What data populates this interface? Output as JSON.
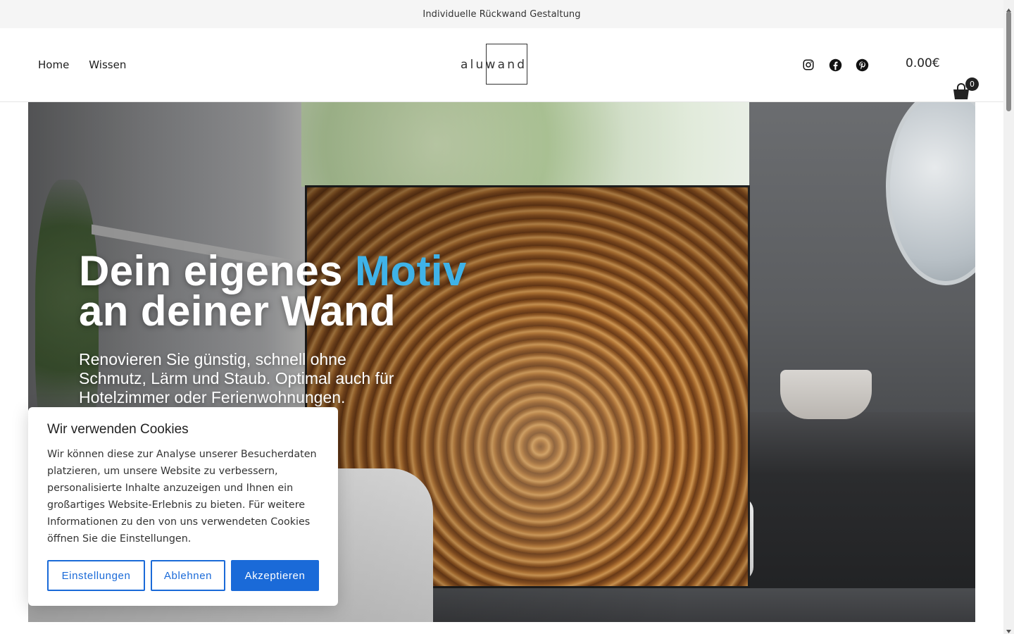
{
  "topbar": {
    "text": "Individuelle Rückwand Gestaltung"
  },
  "nav": {
    "items": [
      {
        "label": "Home"
      },
      {
        "label": "Wissen"
      }
    ]
  },
  "logo": {
    "part1": "alu",
    "part2": "wand"
  },
  "socials": [
    {
      "icon": "instagram-icon"
    },
    {
      "icon": "facebook-icon"
    },
    {
      "icon": "pinterest-icon"
    }
  ],
  "cart": {
    "price": "0.00€",
    "count": "0"
  },
  "hero": {
    "headline_part1": "Dein eigenes ",
    "headline_accent": "Motiv",
    "headline_line2": "an deiner Wand",
    "subline": "Renovieren Sie günstig, schnell ohne Schmutz, Lärm und Staub. Optimal auch für Hotelzimmer oder Ferienwohnungen.",
    "accent_color": "#3fb3e8"
  },
  "cookie": {
    "title": "Wir verwenden Cookies",
    "text": "Wir können diese zur Analyse unserer Besucherdaten platzieren, um unsere Website zu verbessern, personalisierte Inhalte anzuzeigen und Ihnen ein großartiges Website-Erlebnis zu bieten. Für weitere Informationen zu den von uns verwendeten Cookies öffnen Sie die Einstellungen.",
    "buttons": {
      "settings": "Einstellungen",
      "decline": "Ablehnen",
      "accept": "Akzeptieren"
    },
    "button_color": "#1a6ad8"
  }
}
